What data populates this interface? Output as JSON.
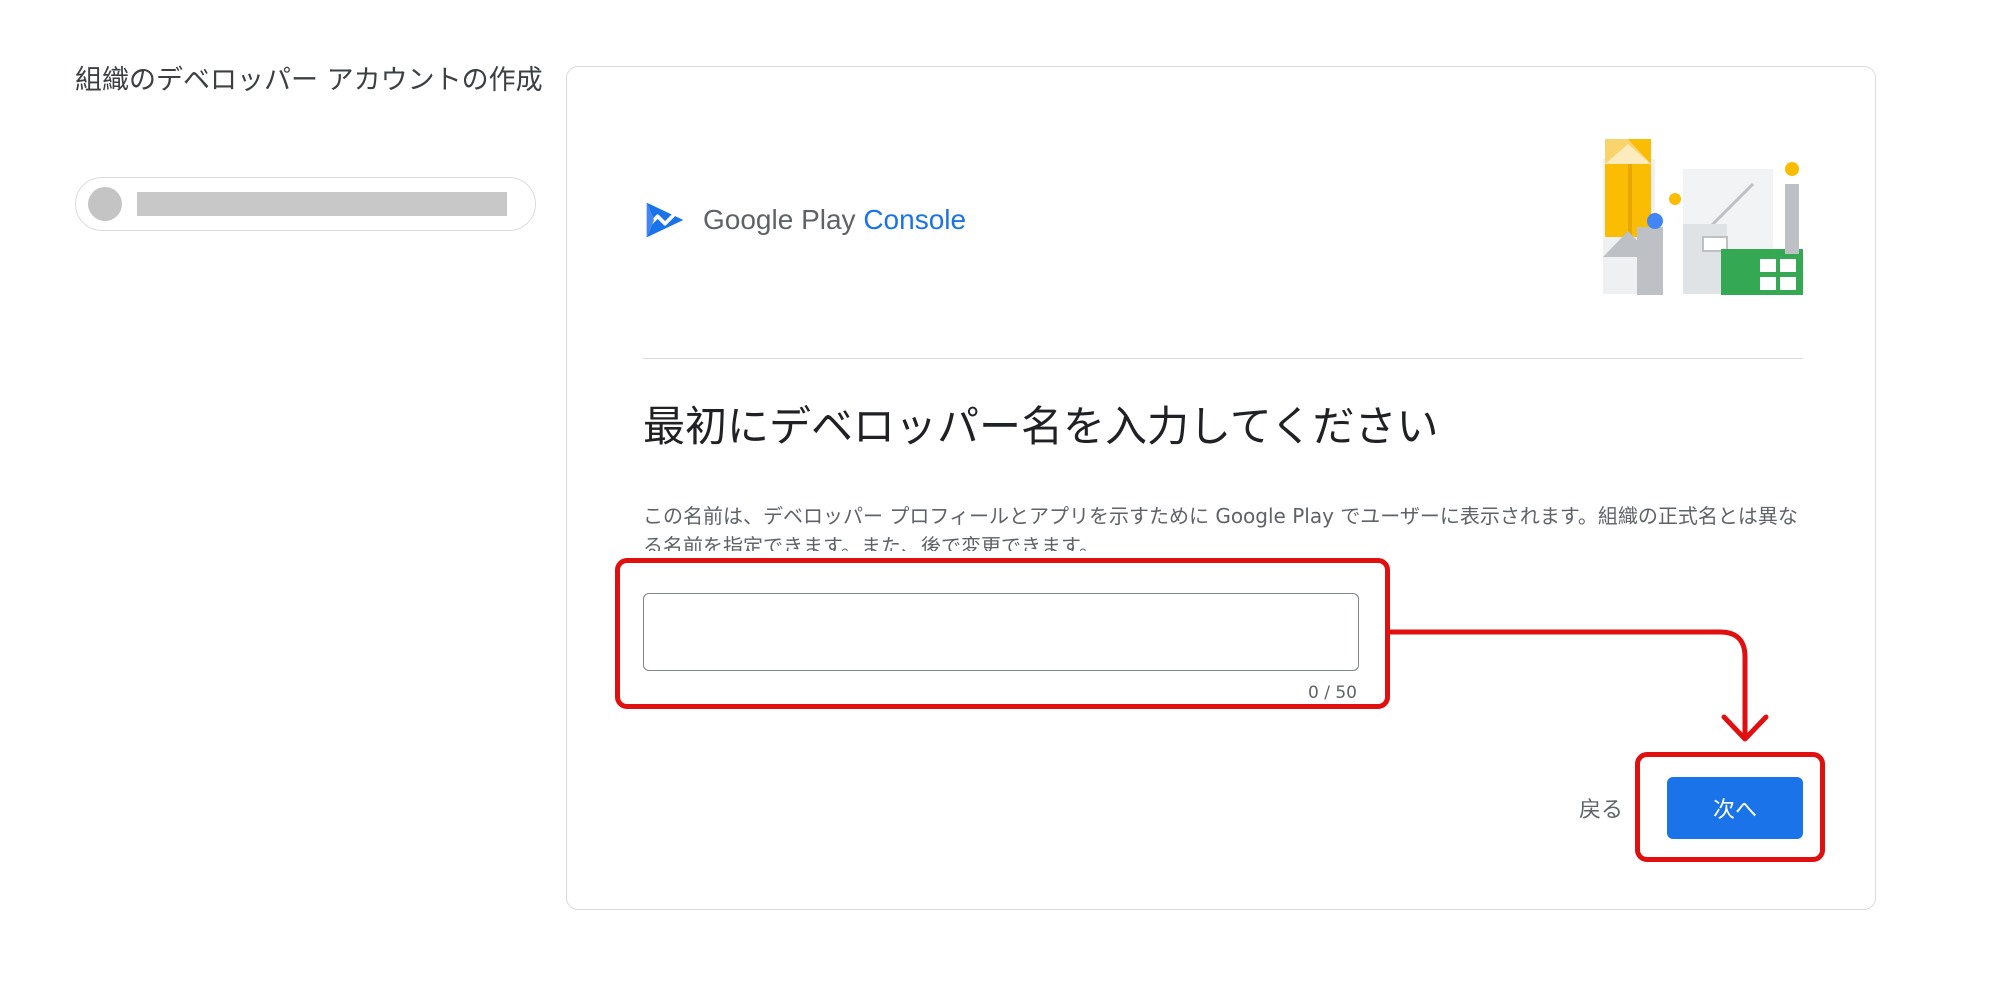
{
  "sidebar": {
    "title": "組織のデベロッパー アカウントの作成"
  },
  "card": {
    "brand": {
      "name": "Google Play",
      "product": "Console"
    },
    "heading": "最初にデベロッパー名を入力してください",
    "description": "この名前は、デベロッパー プロフィールとアプリを示すために Google Play でユーザーに表示されます。組織の正式名とは異なる名前を指定できます。また、後で変更できます。",
    "developer_name_input": {
      "value": "",
      "char_counter": "0 / 50"
    },
    "actions": {
      "back_label": "戻る",
      "next_label": "次へ"
    }
  },
  "colors": {
    "accent": "#1a73e8",
    "annotation": "#e01010",
    "border": "#dadce0"
  },
  "icons": {
    "brand_logo": "play-console-logo-icon",
    "illustration": "google-play-illustration"
  }
}
